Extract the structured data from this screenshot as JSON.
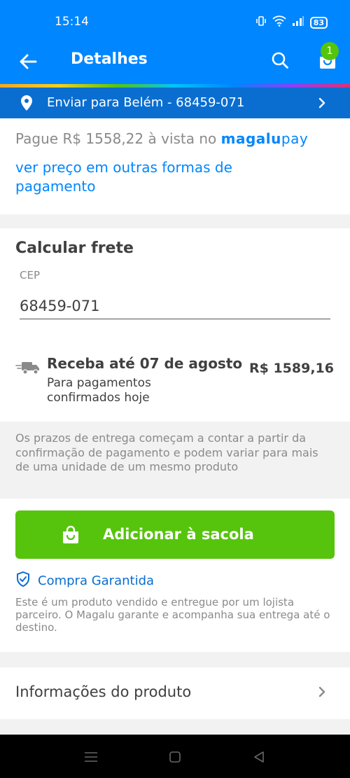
{
  "status_bar": {
    "time": "15:14",
    "battery": "83",
    "icons": [
      "vibrate-icon",
      "wifi-icon",
      "signal-icon",
      "battery-icon"
    ]
  },
  "app_bar": {
    "title": "Detalhes",
    "cart_count": "1",
    "icons": [
      "arrow-left-icon",
      "search-icon",
      "shopping-bag-icon"
    ]
  },
  "delivery": {
    "text": "Enviar para Belém - 68459-071"
  },
  "payment": {
    "prefix": "Pague R$ 1558,22 à vista no ",
    "brand_magalu": "magalu",
    "brand_pay": "pay",
    "other_methods_link": "ver preço em outras formas de pagamento"
  },
  "freight": {
    "title": "Calcular frete",
    "cep_label": "CEP",
    "cep_value": "68459-071",
    "receive_title": "Receba até 07 de agosto",
    "receive_subtitle": "Para pagamentos confirmados hoje",
    "price": "R$ 1589,16"
  },
  "notice": {
    "text": "Os prazos de entrega começam a contar a partir da confirmação de pagamento e podem variar para mais de uma unidade de um mesmo produto"
  },
  "cta": {
    "add_to_bag_label": "Adicionar à sacola",
    "guarantee_label": "Compra Garantida",
    "seller_text": "Este é um produto vendido e entregue por um lojista parceiro. O Magalu garante e acompanha sua entrega até o destino."
  },
  "product_info": {
    "label": "Informações do produto"
  },
  "colors": {
    "primary_blue": "#0086ff",
    "delivery_blue": "#0a6ed1",
    "green": "#56c40c"
  }
}
